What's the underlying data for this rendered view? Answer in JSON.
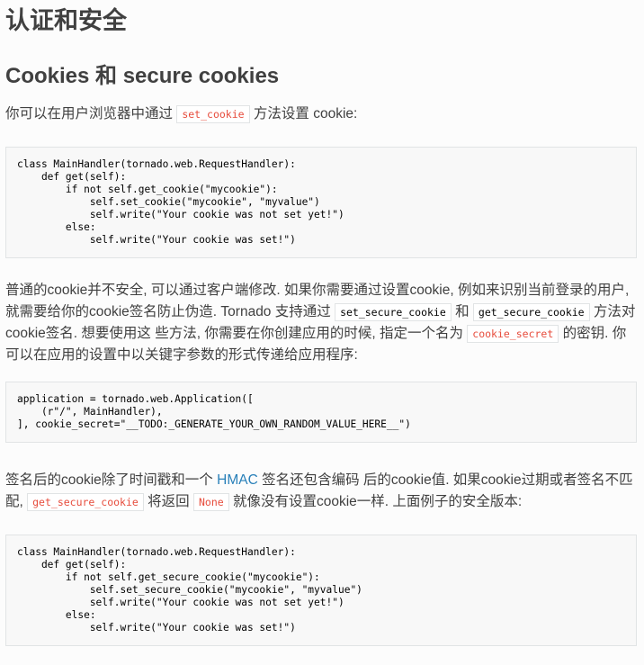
{
  "heading": "认证和安全",
  "subheading": "Cookies 和 secure cookies",
  "intro": {
    "before": "你可以在用户浏览器中通过",
    "code": "set_cookie",
    "after": "方法设置 cookie:"
  },
  "code1": "class MainHandler(tornado.web.RequestHandler):\n    def get(self):\n        if not self.get_cookie(\"mycookie\"):\n            self.set_cookie(\"mycookie\", \"myvalue\")\n            self.write(\"Your cookie was not set yet!\")\n        else:\n            self.write(\"Your cookie was set!\")",
  "para2": {
    "t1": "普通的cookie并不安全, 可以通过客户端修改. 如果你需要通过设置cookie, 例如来识别当前登录的用户, 就需要给你的cookie签名防止伪造. Tornado 支持通过",
    "code1": "set_secure_cookie",
    "t2": "和",
    "code2": "get_secure_cookie",
    "t3": "方法对cookie签名. 想要使用这 些方法, 你需要在你创建应用的时候, 指定一个名为",
    "code3": "cookie_secret",
    "t4": "的密钥. 你可以在应用的设置中以关键字参数的形式传递给应用程序:"
  },
  "code2": "application = tornado.web.Application([\n    (r\"/\", MainHandler),\n], cookie_secret=\"__TODO:_GENERATE_YOUR_OWN_RANDOM_VALUE_HERE__\")",
  "para3": {
    "t1": "签名后的cookie除了时间戳和一个",
    "link": "HMAC",
    "t2": "签名还包含编码 后的cookie值. 如果cookie过期或者签名不匹配,",
    "code1": "get_secure_cookie",
    "t3": "将返回",
    "code2": "None",
    "t4": "就像没有设置cookie一样. 上面例子的安全版本:"
  },
  "code3": "class MainHandler(tornado.web.RequestHandler):\n    def get(self):\n        if not self.get_secure_cookie(\"mycookie\"):\n            self.set_secure_cookie(\"mycookie\", \"myvalue\")\n            self.write(\"Your cookie was not set yet!\")\n        else:\n            self.write(\"Your cookie was set!\")",
  "colors": {
    "text": "#404040",
    "link": "#2980b9",
    "code_red": "#e74c3c",
    "code_bg": "#f8f8f8",
    "border": "#e1e4e5"
  }
}
